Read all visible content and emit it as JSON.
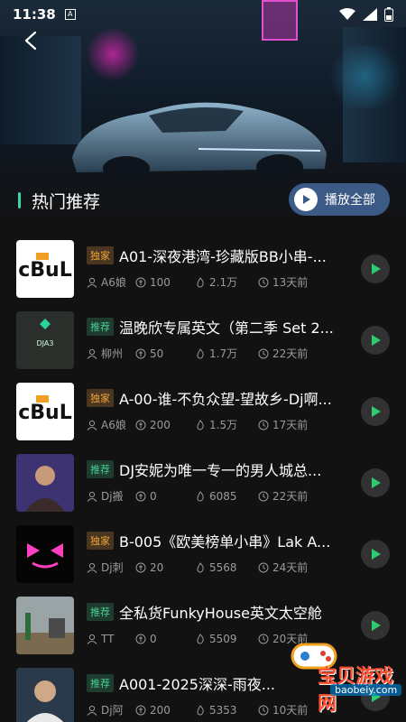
{
  "status_bar": {
    "time": "11:38",
    "a_icon": "A"
  },
  "section": {
    "title": "热门推荐",
    "play_all_label": "播放全部"
  },
  "tags": {
    "exclusive": "独家",
    "recommended": "推荐"
  },
  "items": [
    {
      "tag": "独家",
      "title": "A01-深夜港湾-珍藏版BB小串-...",
      "user": "A6娘",
      "coins": "100",
      "plays": "2.1万",
      "time": "13天前",
      "thumb": "logo"
    },
    {
      "tag": "推荐",
      "title": "温晚欣专属英文（第二季 Set 2...",
      "user": "柳州",
      "coins": "50",
      "plays": "1.7万",
      "time": "22天前",
      "thumb": "dja3"
    },
    {
      "tag": "独家",
      "title": "A-00-谁-不负众望-望故乡-Dj啊...",
      "user": "A6娘",
      "coins": "200",
      "plays": "1.5万",
      "time": "17天前",
      "thumb": "logo"
    },
    {
      "tag": "推荐",
      "title": "DJ安妮为唯一专一的男人城总...",
      "user": "Dj搬",
      "coins": "0",
      "plays": "6085",
      "time": "22天前",
      "thumb": "person"
    },
    {
      "tag": "独家",
      "title": "B-005《欧美榜单小串》Lak A...",
      "user": "Dj刺",
      "coins": "20",
      "plays": "5568",
      "time": "24天前",
      "thumb": "mask"
    },
    {
      "tag": "推荐",
      "title": "全私货FunkyHouse英文太空舱",
      "user": "TT",
      "coins": "0",
      "plays": "5509",
      "time": "20天前",
      "thumb": "street"
    },
    {
      "tag": "推荐",
      "title": "A001-2025深深-雨夜...",
      "user": "Dj阿",
      "coins": "200",
      "plays": "5353",
      "time": "10天前",
      "thumb": "person2"
    }
  ],
  "thumb_texts": {
    "dja3": "DJA3"
  },
  "watermark": {
    "text": "宝贝游戏网",
    "url": "baobeiy.com"
  },
  "colors": {
    "accent": "#38d6b0",
    "play_green": "#2ecc71",
    "play_all_bg": "#3c5a86",
    "exclusive": "#f0a53a",
    "recommended": "#44d191"
  }
}
